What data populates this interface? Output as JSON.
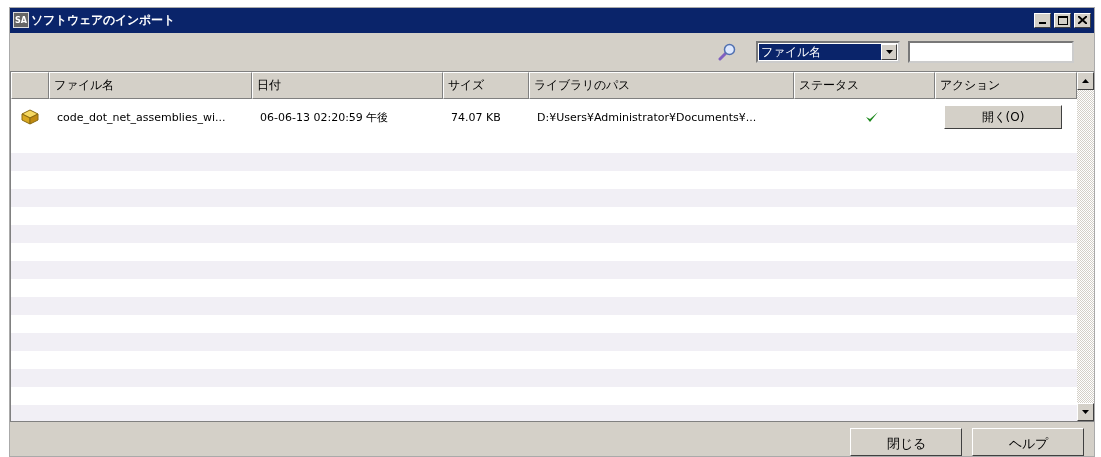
{
  "window": {
    "title": "ソフトウェアのインポート",
    "app_badge": "SA"
  },
  "search": {
    "field": "ファイル名",
    "field_highlighted": true
  },
  "table": {
    "columns": [
      "ファイル名",
      "日付",
      "サイズ",
      "ライブラリのパス",
      "ステータス",
      "アクション"
    ],
    "rows": [
      {
        "file": "code_dot_net_assemblies_wi...",
        "date": "06-06-13 02:20:59 午後",
        "size": "74.07 KB",
        "path": "D:¥Users¥Administrator¥Documents¥...",
        "success": true,
        "action": "開く(O)"
      }
    ]
  },
  "buttons": [
    "閉じる",
    "ヘルプ"
  ]
}
